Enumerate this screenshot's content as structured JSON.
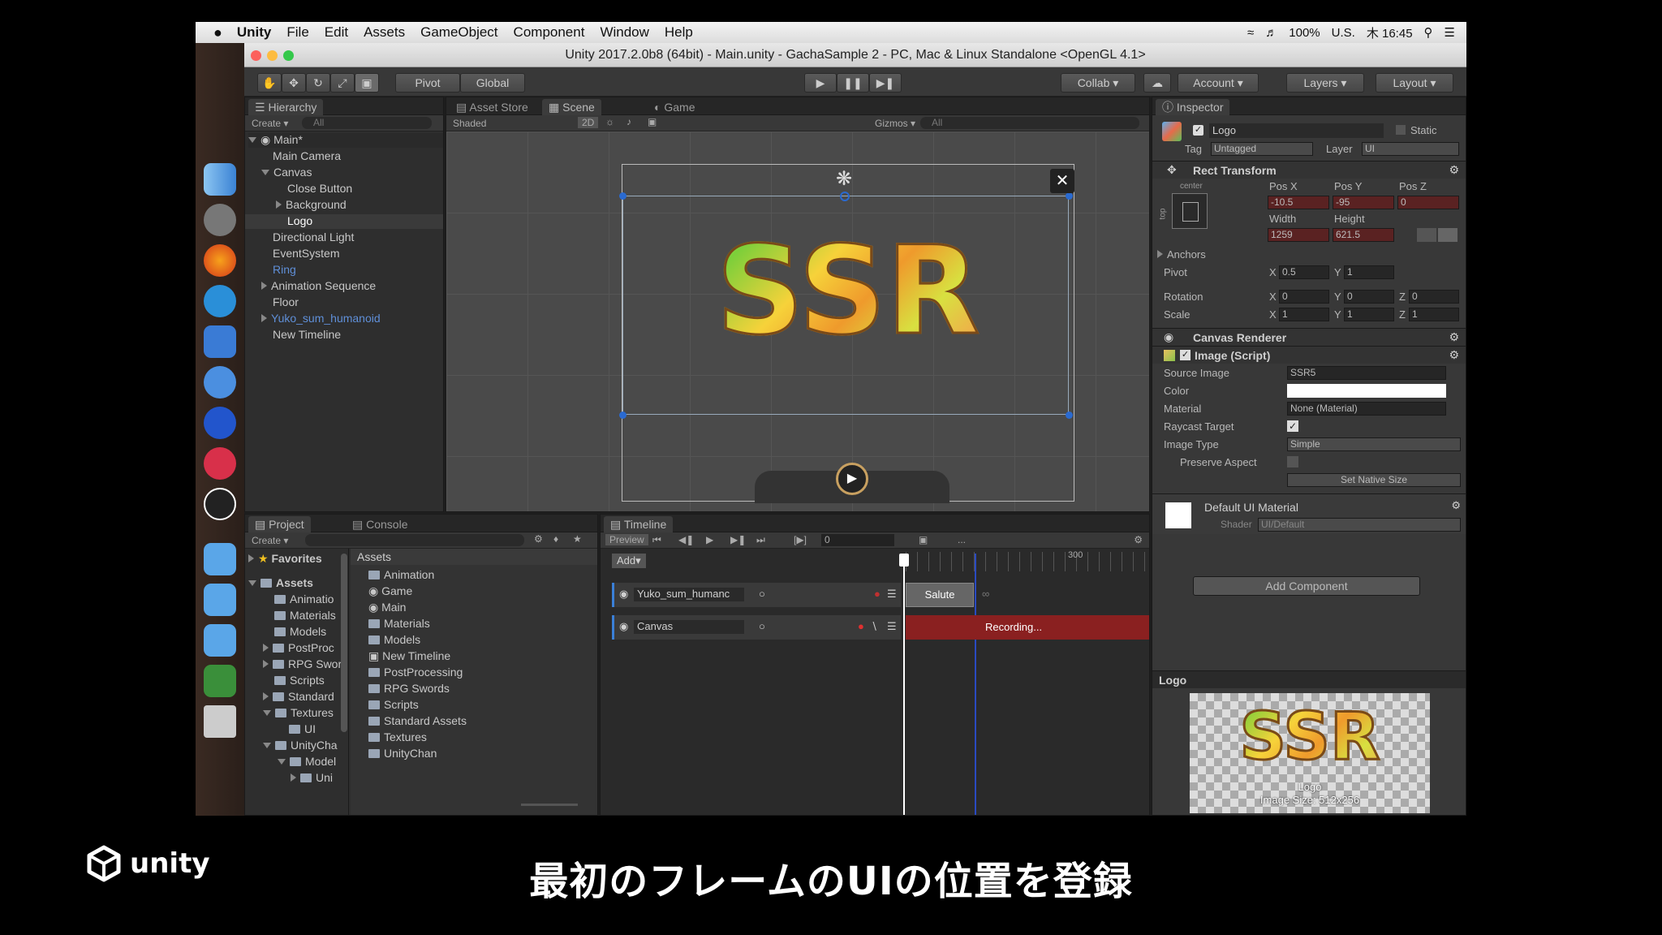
{
  "menubar": {
    "app": "Unity",
    "items": [
      "File",
      "Edit",
      "Assets",
      "GameObject",
      "Component",
      "Window",
      "Help"
    ],
    "battery": "100%",
    "input_source": "U.S.",
    "clock": "木 16:45"
  },
  "window": {
    "title": "Unity 2017.2.0b8 (64bit) - Main.unity - GachaSample 2 - PC, Mac & Linux Standalone <OpenGL 4.1>"
  },
  "toolbar": {
    "pivot": "Pivot",
    "global": "Global",
    "collab": "Collab",
    "account": "Account",
    "layers": "Layers",
    "layout": "Layout"
  },
  "hierarchy": {
    "tab": "Hierarchy",
    "create": "Create",
    "search_placeholder": "All",
    "scene": "Main*",
    "items": [
      {
        "label": "Main Camera",
        "indent": 1,
        "style": "normal"
      },
      {
        "label": "Canvas",
        "indent": 1,
        "style": "normal",
        "expanded": true
      },
      {
        "label": "Close Button",
        "indent": 2,
        "style": "normal"
      },
      {
        "label": "Background",
        "indent": 2,
        "style": "normal",
        "collapsed": true
      },
      {
        "label": "Logo",
        "indent": 2,
        "style": "selected"
      },
      {
        "label": "Directional Light",
        "indent": 1,
        "style": "normal"
      },
      {
        "label": "EventSystem",
        "indent": 1,
        "style": "normal"
      },
      {
        "label": "Ring",
        "indent": 1,
        "style": "prefab"
      },
      {
        "label": "Animation Sequence",
        "indent": 1,
        "style": "normal",
        "collapsed": true
      },
      {
        "label": "Floor",
        "indent": 1,
        "style": "normal"
      },
      {
        "label": "Yuko_sum_humanoid",
        "indent": 1,
        "style": "prefab",
        "collapsed": true
      },
      {
        "label": "New Timeline",
        "indent": 1,
        "style": "normal"
      }
    ]
  },
  "scene_view": {
    "tabs": [
      "Asset Store",
      "Scene",
      "Game"
    ],
    "shading": "Shaded",
    "mode_2d": "2D",
    "gizmos": "Gizmos",
    "search_placeholder": "All",
    "logo_text": "SSR"
  },
  "inspector": {
    "tab": "Inspector",
    "object_name": "Logo",
    "static": "Static",
    "tag_label": "Tag",
    "tag": "Untagged",
    "layer_label": "Layer",
    "layer": "UI",
    "rect_transform": {
      "title": "Rect Transform",
      "anchor_h": "center",
      "anchor_v": "top",
      "pos_x_label": "Pos X",
      "pos_x": "-10.5",
      "pos_y_label": "Pos Y",
      "pos_y": "-95",
      "pos_z_label": "Pos Z",
      "pos_z": "0",
      "width_label": "Width",
      "width": "1259",
      "height_label": "Height",
      "height": "621.5",
      "anchors": "Anchors",
      "pivot": "Pivot",
      "pivot_x": "0.5",
      "pivot_y": "1",
      "rotation": "Rotation",
      "rot_x": "0",
      "rot_y": "0",
      "rot_z": "0",
      "scale": "Scale",
      "scale_x": "1",
      "scale_y": "1",
      "scale_z": "1"
    },
    "canvas_renderer": "Canvas Renderer",
    "image_script": {
      "title": "Image (Script)",
      "source_image_label": "Source Image",
      "source_image": "SSR5",
      "color_label": "Color",
      "material_label": "Material",
      "material": "None (Material)",
      "raycast_label": "Raycast Target",
      "image_type_label": "Image Type",
      "image_type": "Simple",
      "preserve_label": "Preserve Aspect",
      "native_size": "Set Native Size"
    },
    "material": {
      "name": "Default UI Material",
      "shader_label": "Shader",
      "shader": "UI/Default"
    },
    "add_component": "Add Component",
    "preview": {
      "title": "Logo",
      "caption": "Logo",
      "size": "Image Size: 512x256"
    }
  },
  "project": {
    "tabs": [
      "Project",
      "Console"
    ],
    "create": "Create",
    "favorites": "Favorites",
    "tree": [
      {
        "label": "Assets",
        "indent": 0
      },
      {
        "label": "Animatio",
        "indent": 1
      },
      {
        "label": "Materials",
        "indent": 1
      },
      {
        "label": "Models",
        "indent": 1
      },
      {
        "label": "PostProc",
        "indent": 1
      },
      {
        "label": "RPG Swor",
        "indent": 1
      },
      {
        "label": "Scripts",
        "indent": 1
      },
      {
        "label": "Standard",
        "indent": 1
      },
      {
        "label": "Textures",
        "indent": 1
      },
      {
        "label": "UI",
        "indent": 2
      },
      {
        "label": "UnityCha",
        "indent": 1
      },
      {
        "label": "Model",
        "indent": 2
      },
      {
        "label": "Uni",
        "indent": 3
      }
    ],
    "assets_header": "Assets",
    "assets": [
      "Animation",
      "Game",
      "Main",
      "Materials",
      "Models",
      "New Timeline",
      "PostProcessing",
      "RPG Swords",
      "Scripts",
      "Standard Assets",
      "Textures",
      "UnityChan"
    ]
  },
  "timeline": {
    "tab": "Timeline",
    "preview": "Preview",
    "frame": "0",
    "add": "Add",
    "ruler_mark": "300",
    "dots": "...",
    "tracks": [
      {
        "name": "Yuko_sum_humanc",
        "clip": "Salute"
      },
      {
        "name": "Canvas",
        "clip": "Recording..."
      }
    ]
  },
  "subtitle": "最初のフレームのUIの位置を登録",
  "brand": "unity"
}
